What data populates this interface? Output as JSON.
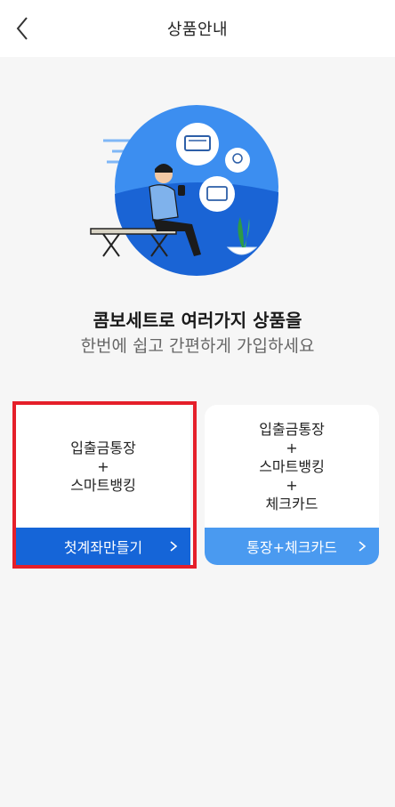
{
  "header": {
    "title": "상품안내"
  },
  "intro": {
    "headline": "콤보세트로 여러가지 상품을",
    "subline": "한번에 쉽고 간편하게 가입하세요"
  },
  "cards": [
    {
      "lines": [
        "입출금통장",
        "+",
        "스마트뱅킹"
      ],
      "button_label": "첫계좌만들기"
    },
    {
      "lines": [
        "입출금통장",
        "+",
        "스마트뱅킹",
        "+",
        "체크카드"
      ],
      "button_label": "통장+체크카드"
    }
  ],
  "colors": {
    "primary": "#1565d8",
    "secondary": "#4a9af0",
    "highlight": "#e51f2a"
  }
}
